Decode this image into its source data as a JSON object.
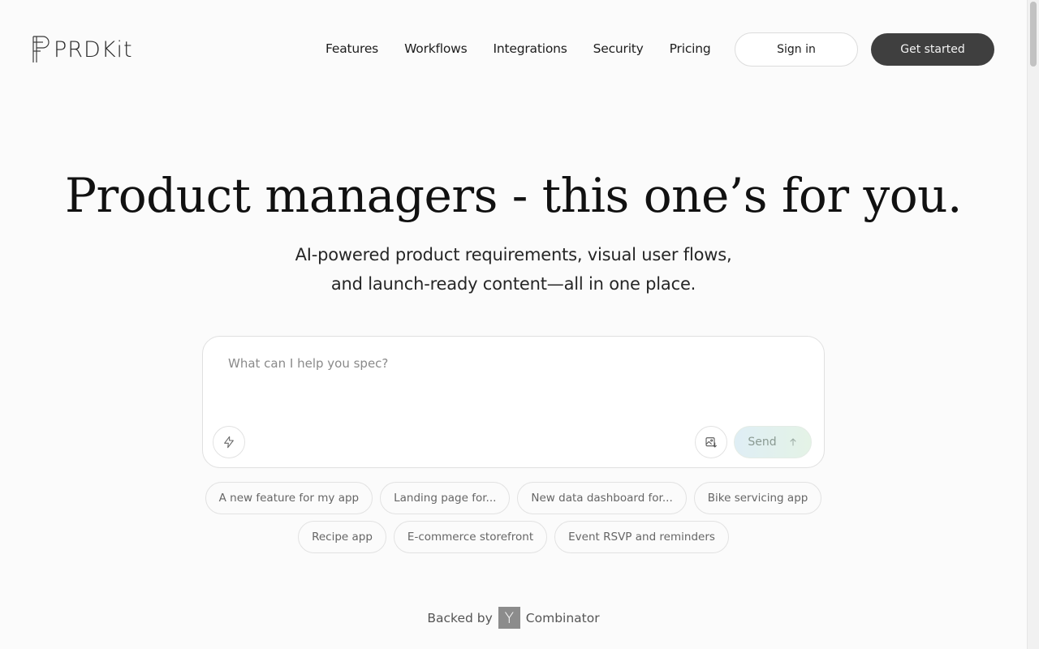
{
  "brand": {
    "name": "PRDKit"
  },
  "nav": {
    "items": [
      {
        "label": "Features"
      },
      {
        "label": "Workflows"
      },
      {
        "label": "Integrations"
      },
      {
        "label": "Security"
      },
      {
        "label": "Pricing"
      }
    ],
    "sign_in": "Sign in",
    "get_started": "Get started"
  },
  "hero": {
    "title": "Product managers - this one’s for you.",
    "subtitle_line1": "AI-powered product requirements, visual user flows,",
    "subtitle_line2": "and launch-ready content—all in one place."
  },
  "composer": {
    "placeholder": "What can I help you spec?",
    "value": "",
    "left_icon": "lightning-icon",
    "attach_icon": "image-upload-icon",
    "send_label": "Send",
    "send_icon": "arrow-up-icon"
  },
  "suggestions": {
    "row1": [
      "A new feature for my app",
      "Landing page for...",
      "New data dashboard for...",
      "Bike servicing app"
    ],
    "row2": [
      "Recipe app",
      "E-commerce storefront",
      "Event RSVP and reminders"
    ]
  },
  "backed": {
    "prefix": "Backed by",
    "logo_letter": "Y",
    "suffix": "Combinator"
  },
  "colors": {
    "primary_button": "#3f3f3f",
    "send_gradient_start": "#dfeef5",
    "send_gradient_end": "#e4f3e6",
    "yc_badge": "#8c8c8c"
  }
}
